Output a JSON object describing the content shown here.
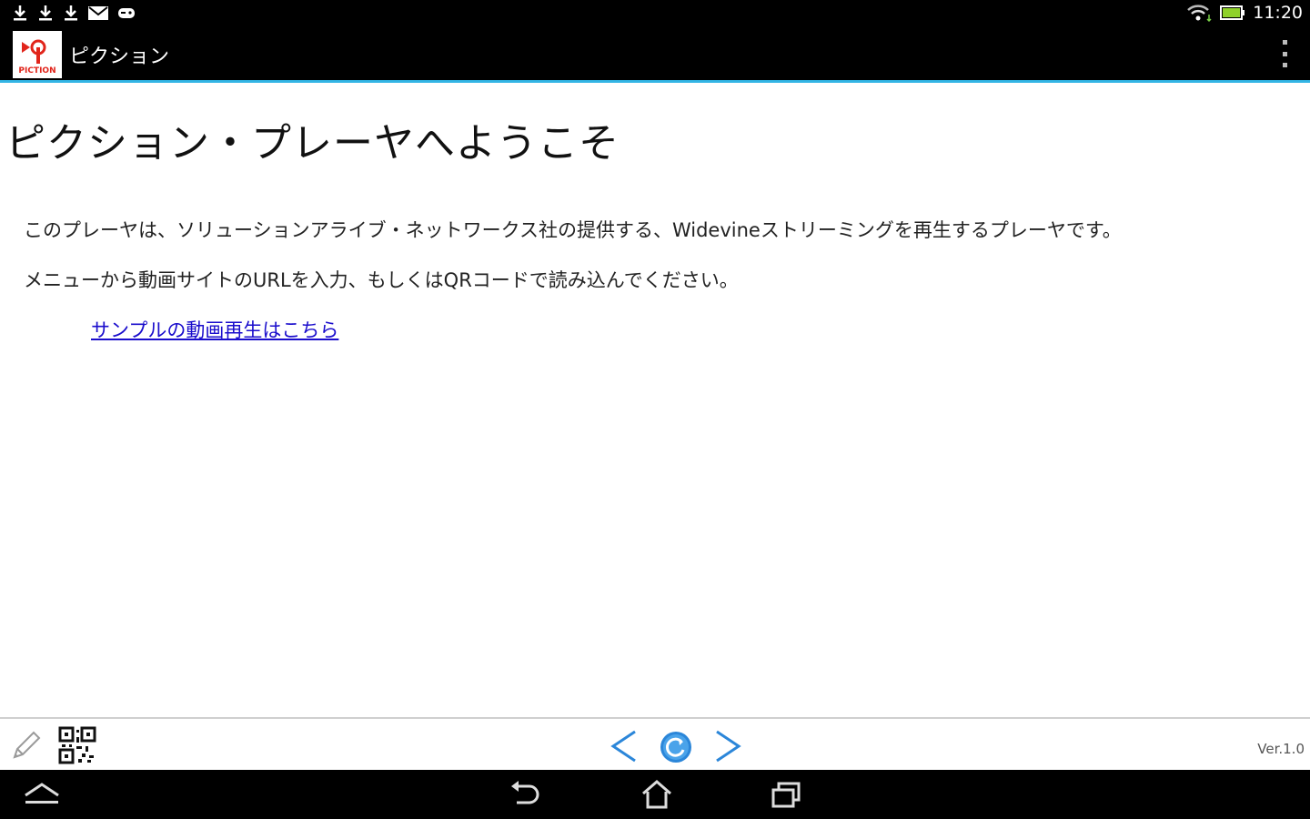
{
  "status_bar": {
    "time": "11:20",
    "icons_left": [
      "download-icon",
      "download-icon",
      "download-icon",
      "gmail-icon",
      "game-controller-icon"
    ],
    "icons_right": [
      "wifi-icon",
      "battery-icon"
    ]
  },
  "action_bar": {
    "app_title": "ピクション",
    "logo_text": "PICTION",
    "overflow_icon": "overflow-menu-icon"
  },
  "content": {
    "title": "ピクション・プレーヤへようこそ",
    "paragraph_1": "このプレーヤは、ソリューションアライブ・ネットワークス社の提供する、Widevineストリーミングを再生するプレーヤです。",
    "paragraph_2": "メニューから動画サイトのURLを入力、もしくはQRコードで読み込んでください。",
    "sample_link": "サンプルの動画再生はこちら"
  },
  "toolbar": {
    "edit_icon": "pencil-icon",
    "qr_icon": "qr-code-icon",
    "back_icon": "chevron-left-icon",
    "reload_icon": "reload-icon",
    "forward_icon": "chevron-right-icon",
    "version": "Ver.1.0"
  },
  "nav_bar": {
    "icons": [
      "hide-nav-icon",
      "back-icon",
      "home-icon",
      "recent-apps-icon"
    ]
  },
  "colors": {
    "accent": "#33b5e5",
    "link": "#1a0dcc",
    "nav_blue": "#2b86d9"
  }
}
